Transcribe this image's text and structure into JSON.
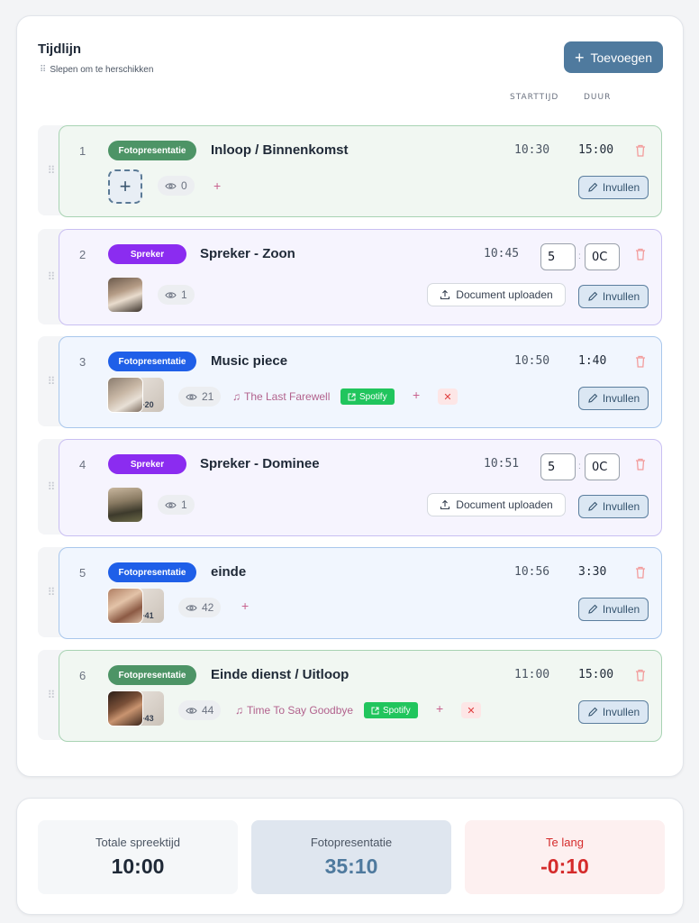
{
  "timeline": {
    "title": "Tijdlijn",
    "subtitle": "Slepen om te herschikken",
    "add_label": "Toevoegen",
    "col_start": "STARTTIJD",
    "col_duration": "DUUR"
  },
  "rows": [
    {
      "num": "1",
      "badge": "Fotopresentatie",
      "title": "Inloop / Binnenkomst",
      "start": "10:30",
      "duration": "15:00",
      "views": "0",
      "edit": "Invullen"
    },
    {
      "num": "2",
      "badge": "Spreker",
      "title": "Spreker - Zoon",
      "start": "10:45",
      "min": "5",
      "sec": "0C",
      "views": "1",
      "upload": "Document uploaden",
      "edit": "Invullen"
    },
    {
      "num": "3",
      "badge": "Fotopresentatie",
      "title": "Music piece",
      "start": "10:50",
      "duration": "1:40",
      "views": "21",
      "extra": "+20",
      "music": "The Last Farewell",
      "spotify": "Spotify",
      "edit": "Invullen"
    },
    {
      "num": "4",
      "badge": "Spreker",
      "title": "Spreker - Dominee",
      "start": "10:51",
      "min": "5",
      "sec": "0C",
      "views": "1",
      "upload": "Document uploaden",
      "edit": "Invullen"
    },
    {
      "num": "5",
      "badge": "Fotopresentatie",
      "title": "einde",
      "start": "10:56",
      "duration": "3:30",
      "views": "42",
      "extra": "+41",
      "edit": "Invullen"
    },
    {
      "num": "6",
      "badge": "Fotopresentatie",
      "title": "Einde dienst / Uitloop",
      "start": "11:00",
      "duration": "15:00",
      "views": "44",
      "extra": "+43",
      "music": "Time To Say Goodbye",
      "spotify": "Spotify",
      "edit": "Invullen"
    }
  ],
  "summary": {
    "spreek_label": "Totale spreektijd",
    "spreek_value": "10:00",
    "foto_label": "Fotopresentatie",
    "foto_value": "35:10",
    "lang_label": "Te lang",
    "lang_value": "-0:10"
  },
  "colors": {
    "accent": "#4f7a9e",
    "foto_badge_green": "#4d9466",
    "foto_badge_blue": "#1f5fe8",
    "spreker_badge": "#8b2cf0",
    "spotify": "#21c55d",
    "danger": "#d52b2b"
  },
  "icons": [
    "drag-handle-icon",
    "plus-icon",
    "trash-icon",
    "eye-icon",
    "music-note-icon",
    "external-link-icon",
    "upload-icon",
    "pencil-icon",
    "close-icon"
  ]
}
